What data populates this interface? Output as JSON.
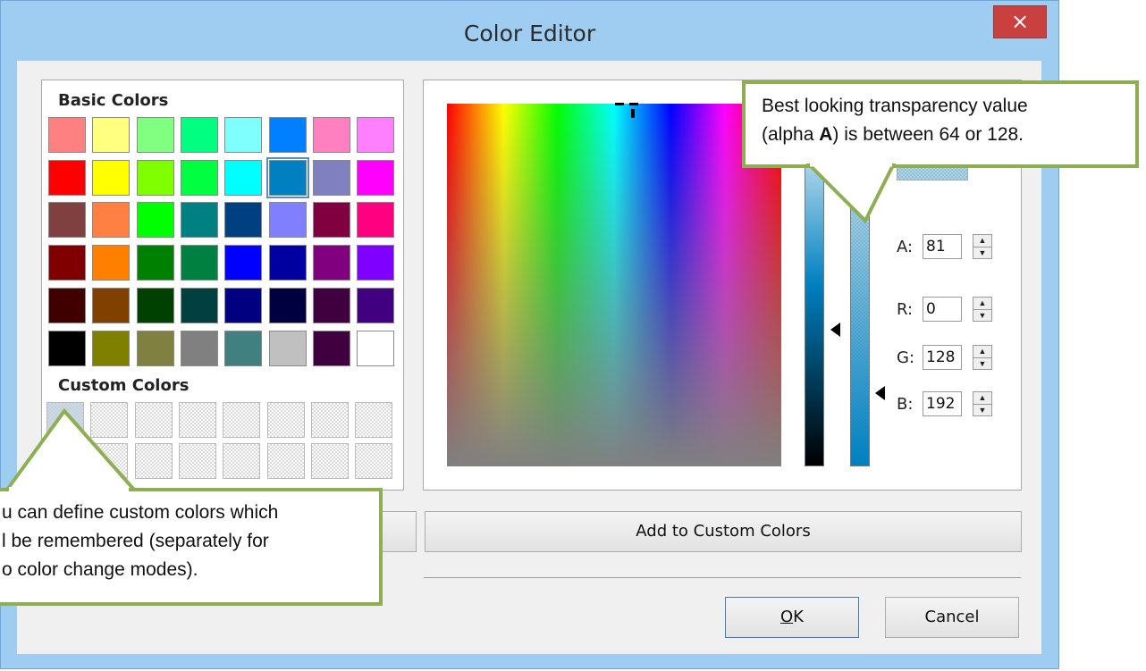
{
  "window": {
    "title": "Color Editor",
    "close_glyph": "×"
  },
  "basic_colors": {
    "label": "Basic Colors",
    "rows": [
      [
        "#ff8080",
        "#ffff80",
        "#80ff80",
        "#00ff80",
        "#80ffff",
        "#0080ff",
        "#ff80c0",
        "#ff80ff"
      ],
      [
        "#ff0000",
        "#ffff00",
        "#80ff00",
        "#00ff40",
        "#00ffff",
        "#0080c0",
        "#8080c0",
        "#ff00ff"
      ],
      [
        "#804040",
        "#ff8040",
        "#00ff00",
        "#008080",
        "#004080",
        "#8080ff",
        "#800040",
        "#ff0080"
      ],
      [
        "#800000",
        "#ff8000",
        "#008000",
        "#008040",
        "#0000ff",
        "#0000a0",
        "#800080",
        "#8000ff"
      ],
      [
        "#400000",
        "#804000",
        "#004000",
        "#004040",
        "#000080",
        "#000040",
        "#400040",
        "#400080"
      ],
      [
        "#000000",
        "#808000",
        "#808040",
        "#808080",
        "#408080",
        "#c0c0c0",
        "#400040",
        "#ffffff"
      ]
    ],
    "selected": "#0080c0"
  },
  "custom_colors": {
    "label": "Custom Colors",
    "count": 16,
    "filled_count": 1
  },
  "alpha_row": {
    "label": "A:",
    "value": "81"
  },
  "red_row": {
    "label": "R:",
    "value": "0"
  },
  "green_row": {
    "label": "G:",
    "value": "128"
  },
  "blue_row": {
    "label": "B:",
    "value": "192"
  },
  "spinner": {
    "up": "▲",
    "down": "▼"
  },
  "buttons": {
    "add_custom": "Add to Custom Colors",
    "ok_mnemonic": "O",
    "ok_rest": "K",
    "cancel": "Cancel"
  },
  "callout_right": {
    "line1": "Best looking transparency value",
    "line2_pre": "(alpha ",
    "line2_bold": "A",
    "line2_post": ") is between 64 or 128."
  },
  "callout_left": {
    "line1": "u can define custom colors which",
    "line2": "l be remembered (separately for",
    "line3": "o color change modes)."
  }
}
